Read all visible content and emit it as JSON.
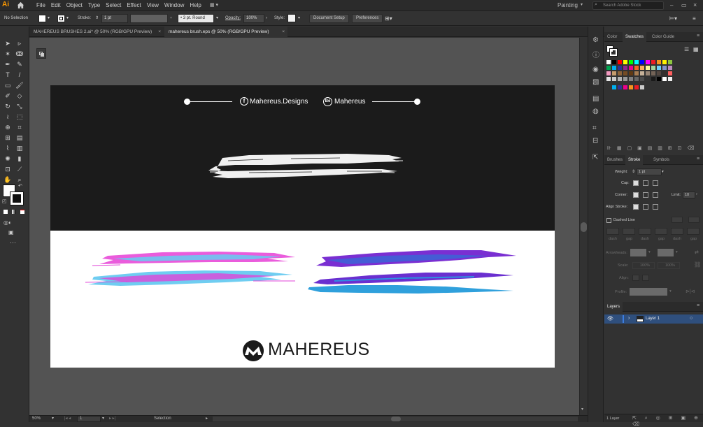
{
  "app": {
    "logo": "Ai"
  },
  "menu": [
    "File",
    "Edit",
    "Object",
    "Type",
    "Select",
    "Effect",
    "View",
    "Window",
    "Help"
  ],
  "workspace": {
    "label": "Painting",
    "search_placeholder": "Search Adobe Stock"
  },
  "control": {
    "selection_status": "No Selection",
    "stroke_label": "Stroke:",
    "stroke_weight": "1 pt",
    "brush_label": "3 pt. Round",
    "opacity_label": "Opacity:",
    "opacity_value": "100%",
    "style_label": "Style:",
    "document_setup": "Document Setup",
    "preferences": "Preferences"
  },
  "tabs": [
    {
      "label": "MAHEREUS BRUSHES 2.ai* @ 50% (RGB/GPU Preview)",
      "close": "×"
    },
    {
      "label": "mahereus brush.eps @ 50% (RGB/GPU Preview)",
      "close": "×"
    }
  ],
  "artboard": {
    "social_facebook": "Mahereus.Designs",
    "social_behance": "Mahereus",
    "fb_glyph": "f",
    "be_glyph": "Bē",
    "brand": "MAHEREUS"
  },
  "status": {
    "zoom": "50%",
    "page": "1",
    "tool": "Selection"
  },
  "color_panel": {
    "tabs": [
      "Color",
      "Swatches",
      "Color Guide"
    ],
    "swatch_rows": [
      [
        "#ffffff",
        "#000000",
        "#ff0000",
        "#ffff00",
        "#00ff00",
        "#00ffff",
        "#0000ff",
        "#ff00ff",
        "#ed1c24",
        "#f7941d",
        "#fff200",
        "#8dc63f"
      ],
      [
        "#00a651",
        "#00aeef",
        "#2e3192",
        "#92278f",
        "#ec008c",
        "#f26522",
        "#fbaf5d",
        "#fff799",
        "#a3d39c",
        "#6dcff6",
        "#8393ca",
        "#bd8cbf"
      ],
      [
        "#f49ac1",
        "#c69c6d",
        "#8c6239",
        "#754c24",
        "#603913",
        "#a67c52",
        "#c7b299",
        "#998675",
        "#736357",
        "#534741",
        "#362f2d",
        "#ff5f5f"
      ],
      [
        "#e6e6e6",
        "#cccccc",
        "#b3b3b3",
        "#999999",
        "#808080",
        "#666666",
        "#4d4d4d",
        "#333333",
        "#1a1a1a",
        "#000000",
        "#ffffff",
        "#f0f0f0"
      ]
    ],
    "brush_rows": [
      "#00aeef",
      "#2e3192",
      "#ec008c",
      "#f7941d",
      "#ed1c24",
      "#cccccc"
    ]
  },
  "stroke_panel": {
    "tabs": [
      "Brushes",
      "Stroke",
      "Symbols"
    ],
    "weight_label": "Weight:",
    "weight_value": "1 pt",
    "cap_label": "Cap:",
    "corner_label": "Corner:",
    "limit_label": "Limit:",
    "limit_value": "10",
    "align_label": "Align Stroke:",
    "dashed_label": "Dashed Line",
    "dash_labels": [
      "dash",
      "gap",
      "dash",
      "gap",
      "dash",
      "gap"
    ],
    "arrowheads_label": "Arrowheads:",
    "scale_label": "Scale:",
    "scale_values": [
      "100%",
      "100%"
    ],
    "align_label2": "Align:",
    "profile_label": "Profile:"
  },
  "layers_panel": {
    "tab": "Layers",
    "layer_name": "Layer 1",
    "count": "1 Layer"
  },
  "colors": {
    "accent": "#ff9a00",
    "selection": "#2f5aa8"
  }
}
